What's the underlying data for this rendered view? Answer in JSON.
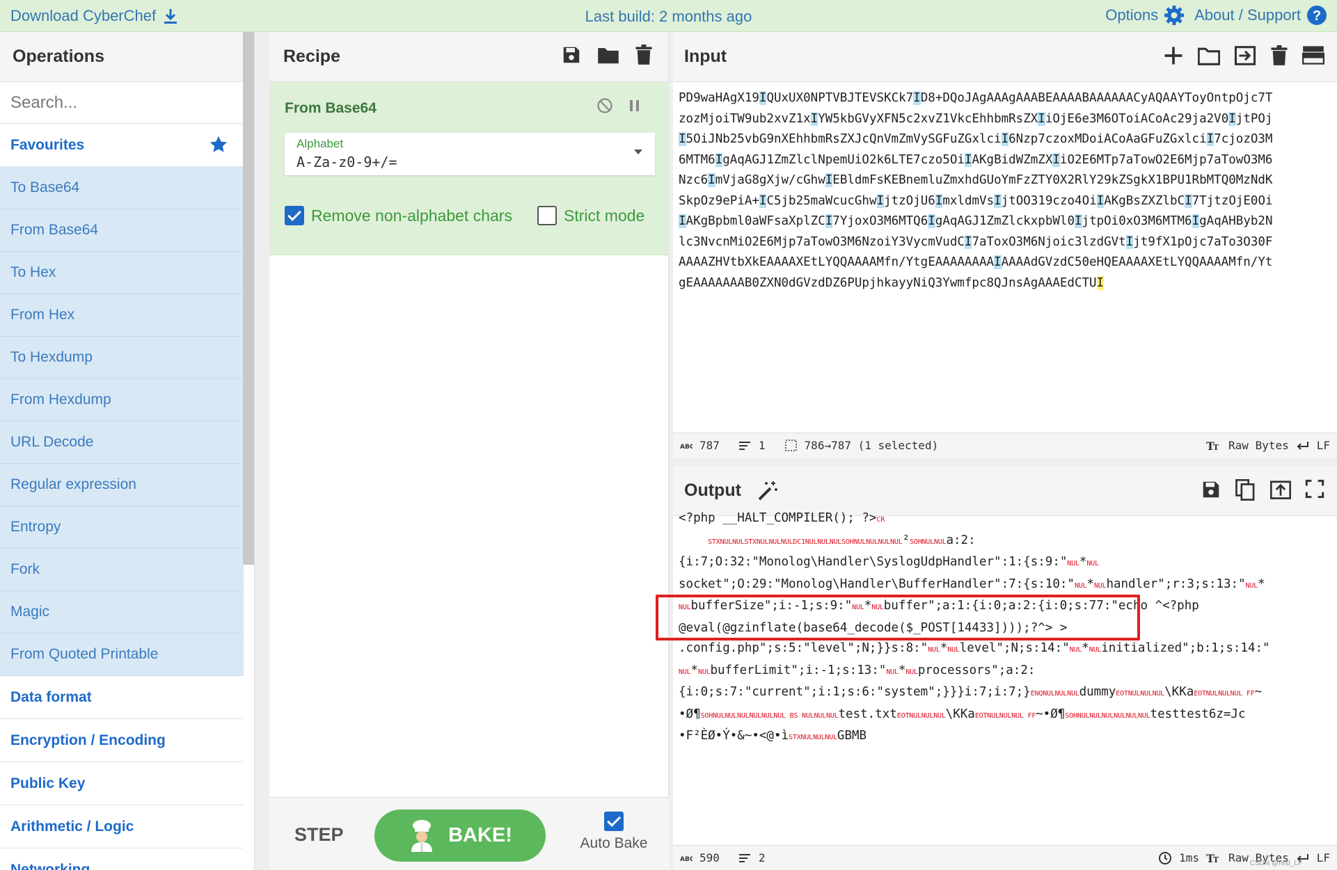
{
  "banner": {
    "download_label": "Download CyberChef",
    "build_label": "Last build: 2 months ago",
    "options_label": "Options",
    "about_label": "About / Support",
    "color": "#dff0d8"
  },
  "operations": {
    "title": "Operations",
    "search_placeholder": "Search...",
    "favourites_label": "Favourites",
    "items": [
      "To Base64",
      "From Base64",
      "To Hex",
      "From Hex",
      "To Hexdump",
      "From Hexdump",
      "URL Decode",
      "Regular expression",
      "Entropy",
      "Fork",
      "Magic",
      "From Quoted Printable"
    ],
    "categories": [
      "Data format",
      "Encryption / Encoding",
      "Public Key",
      "Arithmetic / Logic",
      "Networking"
    ]
  },
  "recipe": {
    "title": "Recipe",
    "operation_name": "From Base64",
    "alphabet_label": "Alphabet",
    "alphabet_value": "A-Za-z0-9+/=",
    "remove_label": "Remove non-alphabet chars",
    "strict_label": "Strict mode",
    "step_label": "STEP",
    "bake_label": "BAKE!",
    "autobake_label": "Auto Bake"
  },
  "input": {
    "title": "Input",
    "status": {
      "length": "787",
      "lines": "1",
      "selection": "786→787 (1 selected)",
      "encoding": "Raw Bytes",
      "eol": "LF"
    }
  },
  "output": {
    "title": "Output",
    "status": {
      "length": "590",
      "lines": "2",
      "time": "1ms",
      "encoding": "Raw Bytes",
      "eol": "LF"
    }
  },
  "watermark": "CSDN @nnd_LF"
}
